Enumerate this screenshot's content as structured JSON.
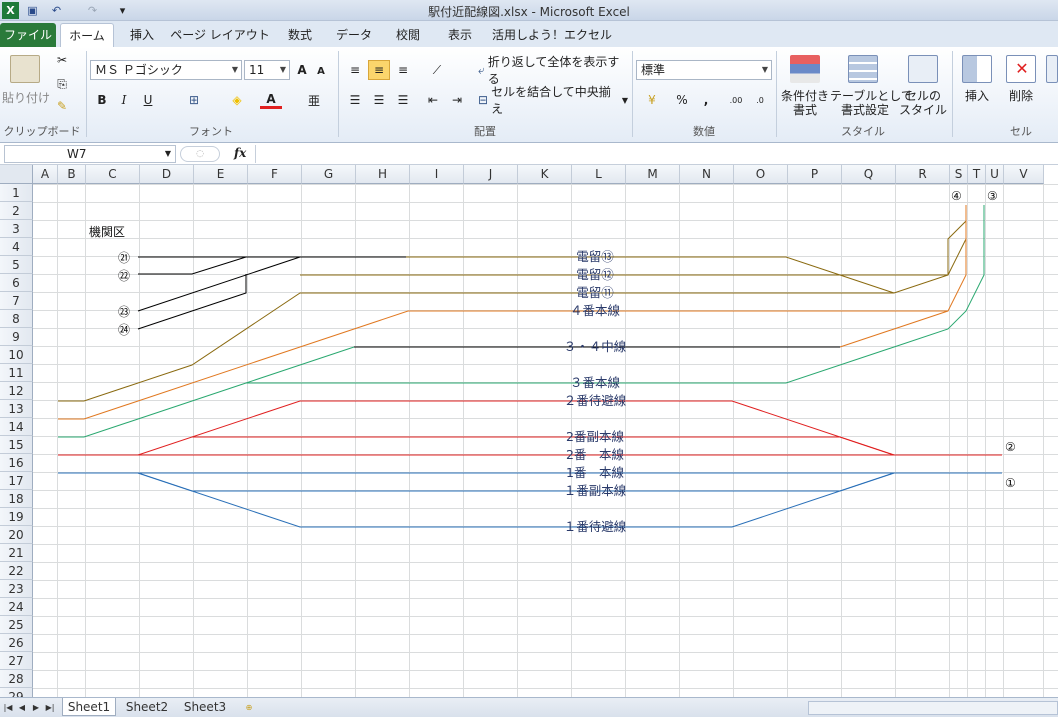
{
  "window": {
    "title": "駅付近配線図.xlsx - Microsoft Excel"
  },
  "ribbon": {
    "tabs": [
      "ファイル",
      "ホーム",
      "挿入",
      "ページ レイアウト",
      "数式",
      "データ",
      "校閲",
      "表示",
      "活用しよう！エクセル"
    ],
    "clipboard": {
      "paste_label": "貼り付け",
      "group_label": "クリップボード"
    },
    "font": {
      "name": "ＭＳ Ｐゴシック",
      "size": "11",
      "bold": "B",
      "italic": "I",
      "underline": "U",
      "group_label": "フォント"
    },
    "alignment": {
      "wrap_label": "折り返して全体を表示する",
      "merge_label": "セルを結合して中央揃え",
      "group_label": "配置"
    },
    "number": {
      "format": "標準",
      "percent": "%",
      "comma": ",",
      "group_label": "数値"
    },
    "styles": {
      "conditional_label": "条件付き\n書式",
      "table_label": "テーブルとして\n書式設定",
      "cell_style_label": "セルの\nスタイル",
      "group_label": "スタイル"
    },
    "cells": {
      "insert_label": "挿入",
      "delete_label": "削除",
      "group_label": "セル"
    }
  },
  "formula_bar": {
    "name_box": "W7",
    "fx": "fx",
    "value": ""
  },
  "grid": {
    "columns": [
      "A",
      "B",
      "C",
      "D",
      "E",
      "F",
      "G",
      "H",
      "I",
      "J",
      "K",
      "L",
      "M",
      "N",
      "O",
      "P",
      "Q",
      "R",
      "S",
      "T",
      "U",
      "V"
    ],
    "rows": [
      "1",
      "2",
      "3",
      "4",
      "5",
      "6",
      "7",
      "8",
      "9",
      "10",
      "11",
      "12",
      "13",
      "14",
      "15",
      "16",
      "17",
      "18",
      "19",
      "20",
      "21",
      "22",
      "23",
      "24",
      "25",
      "26",
      "27",
      "28",
      "29"
    ]
  },
  "diagram": {
    "depot_label": "機関区",
    "siding_labels": [
      "㉑",
      "㉒",
      "㉓",
      "㉔"
    ],
    "track_labels": {
      "t13": "電留⑬",
      "t12": "電留⑫",
      "t11": "電留⑪",
      "line4": "４番本線",
      "mid34": "３・４中線",
      "line3": "３番本線",
      "wait2": "２番待避線",
      "sub2": "2番副本線",
      "main2": "2番　本線",
      "main1": "1番　本線",
      "sub1": "１番副本線",
      "wait1": "１番待避線"
    },
    "end_markers": {
      "m4": "④",
      "m3": "③",
      "m2": "②",
      "m1": "①"
    },
    "colors": {
      "black": "#000000",
      "brown": "#8a6a10",
      "orange": "#e07820",
      "green": "#2aa870",
      "red": "#e02020",
      "blue": "#2a70b8"
    }
  },
  "sheets": {
    "tabs": [
      "Sheet1",
      "Sheet2",
      "Sheet3"
    ],
    "active": "Sheet1"
  }
}
